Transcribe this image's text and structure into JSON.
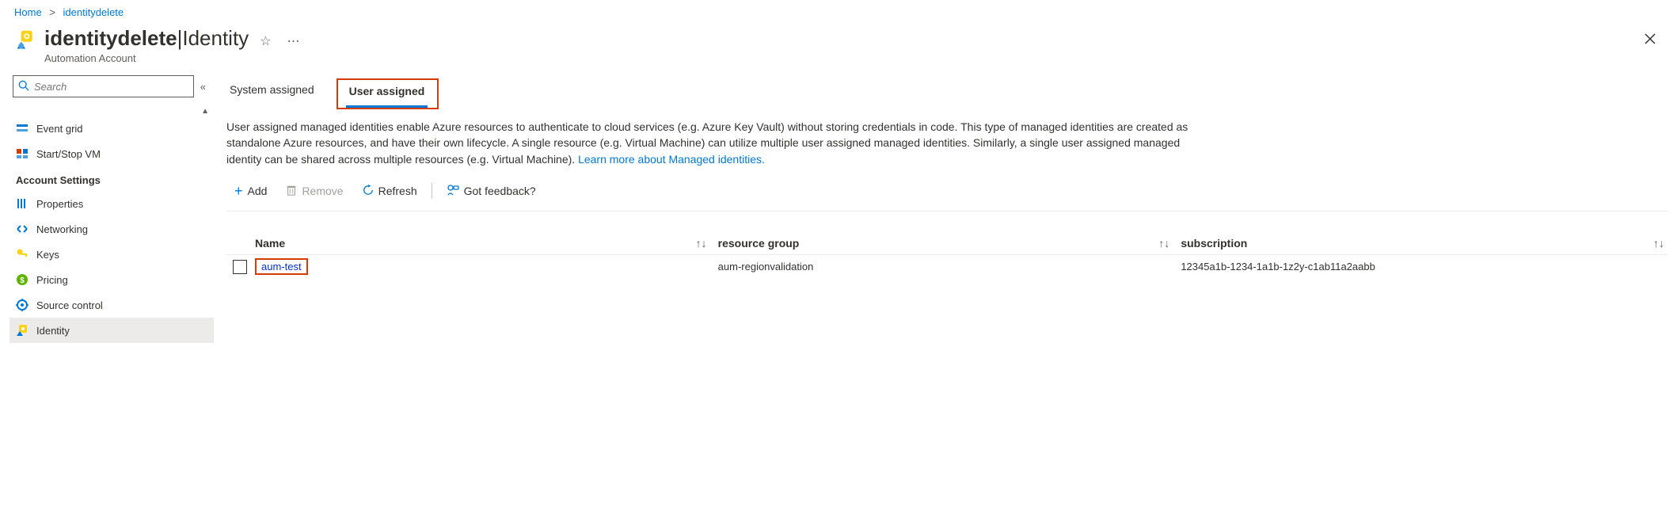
{
  "breadcrumb": {
    "home": "Home",
    "current": "identitydelete"
  },
  "header": {
    "title_bold": "identitydelete",
    "title_sep": " | ",
    "title_thin": "Identity",
    "subtitle": "Automation Account"
  },
  "search": {
    "placeholder": "Search"
  },
  "nav": {
    "items_top": [
      {
        "label": "Event grid",
        "icon": "event-grid"
      },
      {
        "label": "Start/Stop VM",
        "icon": "startstop"
      }
    ],
    "section": "Account Settings",
    "items_settings": [
      {
        "label": "Properties",
        "icon": "properties"
      },
      {
        "label": "Networking",
        "icon": "networking"
      },
      {
        "label": "Keys",
        "icon": "keys"
      },
      {
        "label": "Pricing",
        "icon": "pricing"
      },
      {
        "label": "Source control",
        "icon": "sourcecontrol"
      },
      {
        "label": "Identity",
        "icon": "identity",
        "selected": true
      }
    ]
  },
  "tabs": {
    "system": "System assigned",
    "user": "User assigned"
  },
  "description": {
    "text": "User assigned managed identities enable Azure resources to authenticate to cloud services (e.g. Azure Key Vault) without storing credentials in code. This type of managed identities are created as standalone Azure resources, and have their own lifecycle. A single resource (e.g. Virtual Machine) can utilize multiple user assigned managed identities. Similarly, a single user assigned managed identity can be shared across multiple resources (e.g. Virtual Machine). ",
    "link": "Learn more about Managed identities."
  },
  "toolbar": {
    "add": "Add",
    "remove": "Remove",
    "refresh": "Refresh",
    "feedback": "Got feedback?"
  },
  "table": {
    "columns": {
      "name": "Name",
      "rg": "resource group",
      "sub": "subscription"
    },
    "rows": [
      {
        "name": "aum-test",
        "rg": "aum-regionvalidation",
        "sub": "12345a1b-1234-1a1b-1z2y-c1ab11a2aabb"
      }
    ]
  }
}
